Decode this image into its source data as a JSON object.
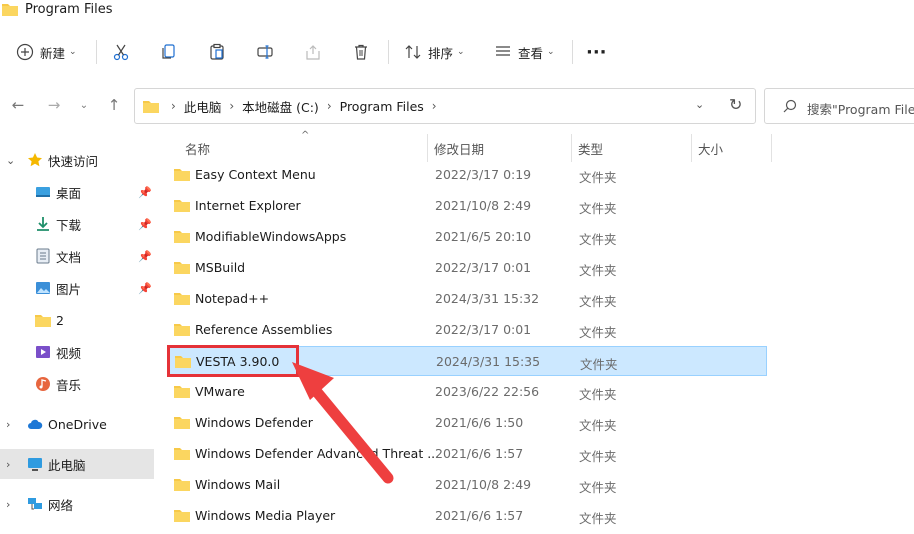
{
  "window": {
    "title": "Program Files"
  },
  "toolbar": {
    "new_label": "新建",
    "sort_label": "排序",
    "view_label": "查看",
    "more_label": "···"
  },
  "address": {
    "crumbs": [
      "此电脑",
      "本地磁盘 (C:)",
      "Program Files"
    ]
  },
  "search": {
    "placeholder": "搜索\"Program Files\""
  },
  "sidebar": {
    "items": [
      {
        "label": "快速访问",
        "icon": "star-icon"
      },
      {
        "label": "桌面",
        "icon": "desktop-icon"
      },
      {
        "label": "下载",
        "icon": "download-icon"
      },
      {
        "label": "文档",
        "icon": "document-icon"
      },
      {
        "label": "图片",
        "icon": "picture-icon"
      },
      {
        "label": "2",
        "icon": "folder-icon"
      },
      {
        "label": "视频",
        "icon": "video-icon"
      },
      {
        "label": "音乐",
        "icon": "music-icon"
      },
      {
        "label": "OneDrive",
        "icon": "cloud-icon"
      },
      {
        "label": "此电脑",
        "icon": "computer-icon"
      },
      {
        "label": "网络",
        "icon": "network-icon"
      }
    ]
  },
  "columns": {
    "name": "名称",
    "modified": "修改日期",
    "type": "类型",
    "size": "大小"
  },
  "files": [
    {
      "name": "Easy Context Menu",
      "modified": "2022/3/17 0:19",
      "type": "文件夹"
    },
    {
      "name": "Internet Explorer",
      "modified": "2021/10/8 2:49",
      "type": "文件夹"
    },
    {
      "name": "ModifiableWindowsApps",
      "modified": "2021/6/5 20:10",
      "type": "文件夹"
    },
    {
      "name": "MSBuild",
      "modified": "2022/3/17 0:01",
      "type": "文件夹"
    },
    {
      "name": "Notepad++",
      "modified": "2024/3/31 15:32",
      "type": "文件夹"
    },
    {
      "name": "Reference Assemblies",
      "modified": "2022/3/17 0:01",
      "type": "文件夹"
    },
    {
      "name": "VESTA 3.90.0",
      "modified": "2024/3/31 15:35",
      "type": "文件夹"
    },
    {
      "name": "VMware",
      "modified": "2023/6/22 22:56",
      "type": "文件夹"
    },
    {
      "name": "Windows Defender",
      "modified": "2021/6/6 1:50",
      "type": "文件夹"
    },
    {
      "name": "Windows Defender Advanced Threat ...",
      "modified": "2021/6/6 1:57",
      "type": "文件夹"
    },
    {
      "name": "Windows Mail",
      "modified": "2021/10/8 2:49",
      "type": "文件夹"
    },
    {
      "name": "Windows Media Player",
      "modified": "2021/6/6 1:57",
      "type": "文件夹"
    }
  ],
  "colors": {
    "selection": "#cce8ff",
    "highlight": "#e53238",
    "folder": "#f7c948"
  }
}
